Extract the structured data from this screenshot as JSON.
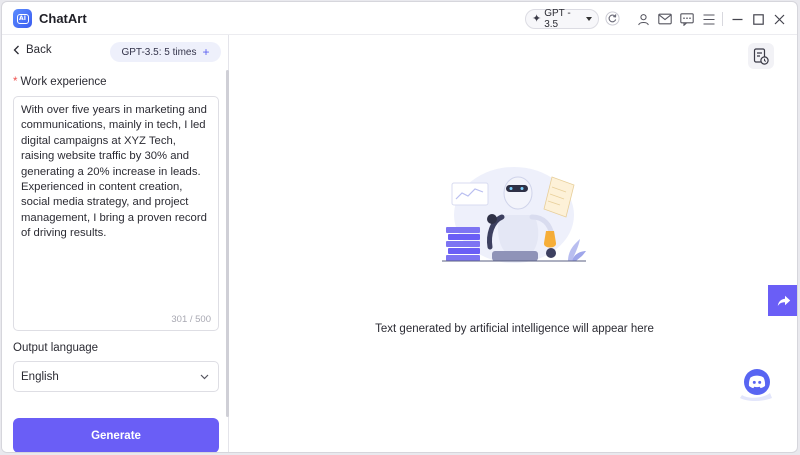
{
  "app": {
    "title": "ChatArt",
    "logo_text": "AI"
  },
  "titlebar": {
    "model_label": "GPT - 3.5",
    "icons": [
      "refresh-icon",
      "user-icon",
      "mail-icon",
      "feedback-icon",
      "menu-icon",
      "minimize-icon",
      "maximize-icon",
      "close-icon"
    ]
  },
  "left": {
    "back_label": "Back",
    "quota_label": "GPT-3.5: 5 times",
    "quota_plus": "+",
    "work_label": "Work experience",
    "required_mark": "*",
    "work_text": "With over five years in marketing and communications, mainly in tech, I led digital campaigns at XYZ Tech, raising website traffic by 30% and generating a 20% increase in leads. Experienced in content creation, social media strategy, and project management, I bring a proven record of driving results.",
    "char_count": "301 / 500",
    "lang_label": "Output language",
    "lang_value": "English",
    "generate_label": "Generate"
  },
  "right": {
    "placeholder": "Text generated by artificial intelligence will appear here"
  },
  "colors": {
    "accent": "#6a5ef6",
    "required": "#ef5350",
    "border": "#dedee4"
  }
}
